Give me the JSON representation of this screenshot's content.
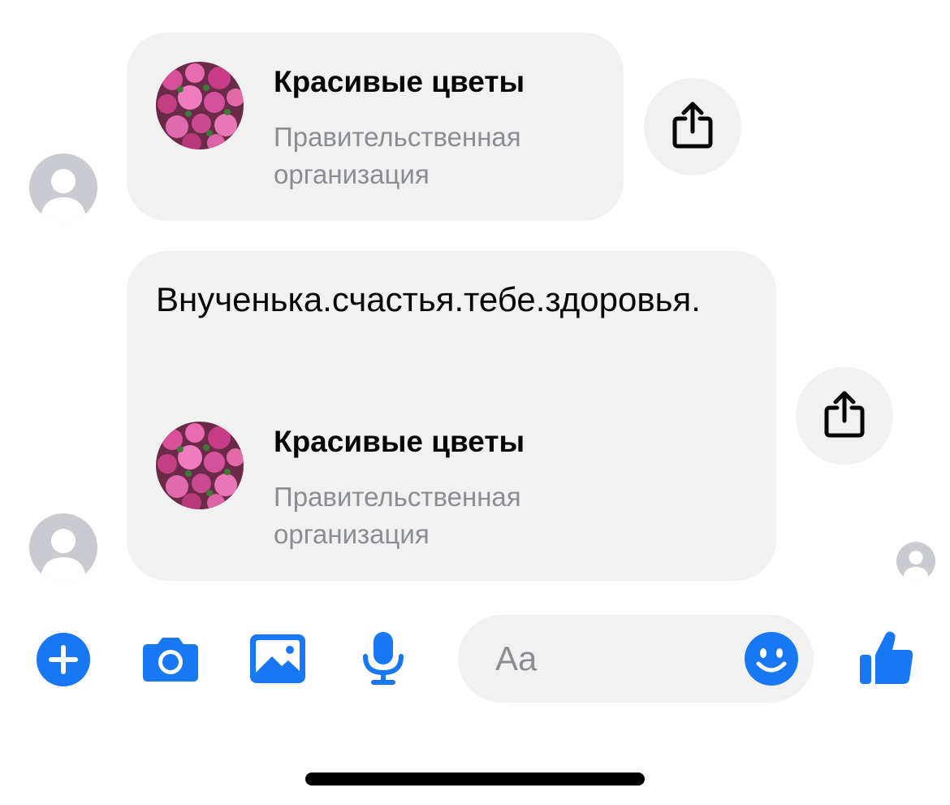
{
  "messages": [
    {
      "type": "page-share",
      "page": {
        "name": "Красивые цветы",
        "category": "Правительственная организация"
      }
    },
    {
      "type": "text-with-page-share",
      "text": "Внученька.счастья.тебе.здоровья.",
      "page": {
        "name": "Красивые цветы",
        "category": "Правительственная организация"
      }
    }
  ],
  "icons": {
    "share": "share-icon",
    "add": "plus-circle-icon",
    "camera": "camera-icon",
    "gallery": "image-icon",
    "microphone": "microphone-icon",
    "emoji": "smiley-icon",
    "like": "thumbs-up-icon"
  },
  "composer": {
    "placeholder": "Aa"
  },
  "colors": {
    "accent": "#1877f2",
    "bubble": "#f1f1f2",
    "avatar": "#c9cbd0",
    "secondary_text": "#8a8d91"
  }
}
